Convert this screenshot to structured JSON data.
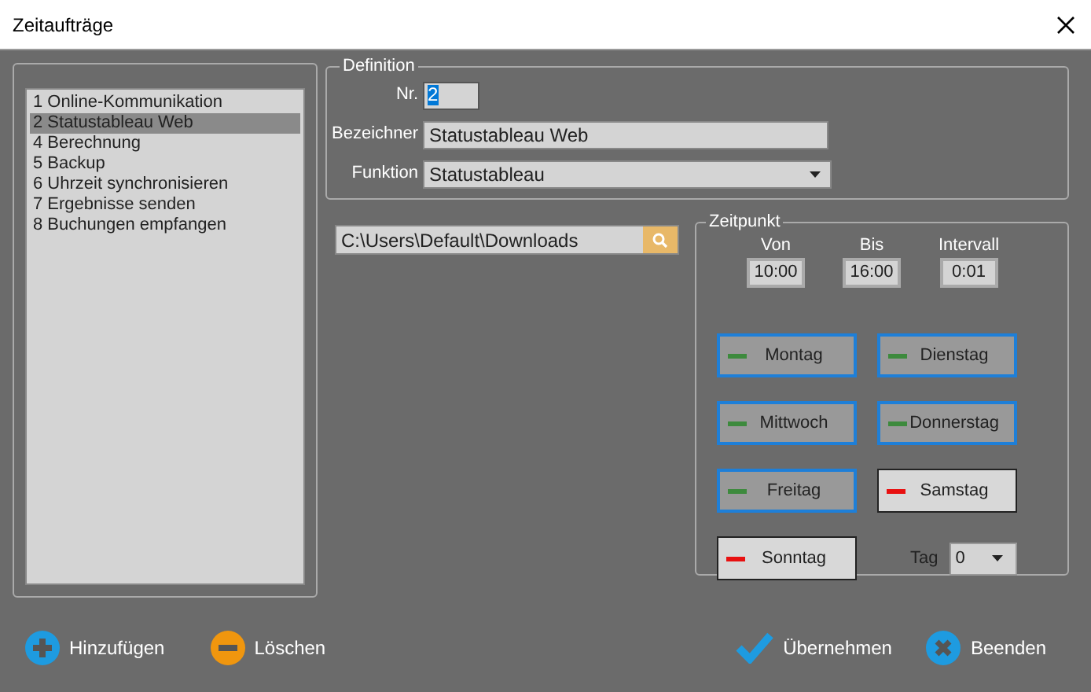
{
  "window": {
    "title": "Zeitaufträge"
  },
  "jobs": [
    {
      "label": "1 Online-Kommunikation",
      "selected": false
    },
    {
      "label": "2 Statustableau Web",
      "selected": true
    },
    {
      "label": "4 Berechnung",
      "selected": false
    },
    {
      "label": "5 Backup",
      "selected": false
    },
    {
      "label": "6 Uhrzeit synchronisieren",
      "selected": false
    },
    {
      "label": "7 Ergebnisse senden",
      "selected": false
    },
    {
      "label": "8 Buchungen empfangen",
      "selected": false
    }
  ],
  "definition": {
    "title": "Definition",
    "nr_label": "Nr.",
    "nr_value": "2",
    "name_label": "Bezeichner",
    "name_value": "Statustableau Web",
    "function_label": "Funktion",
    "function_value": "Statustableau"
  },
  "path": {
    "value": "C:\\Users\\Default\\Downloads"
  },
  "schedule": {
    "title": "Zeitpunkt",
    "from_label": "Von",
    "from_value": "10:00",
    "to_label": "Bis",
    "to_value": "16:00",
    "interval_label": "Intervall",
    "interval_value": "0:01",
    "days": [
      {
        "label": "Montag",
        "on": true
      },
      {
        "label": "Dienstag",
        "on": true
      },
      {
        "label": "Mittwoch",
        "on": true
      },
      {
        "label": "Donnerstag",
        "on": true
      },
      {
        "label": "Freitag",
        "on": true
      },
      {
        "label": "Samstag",
        "on": false
      },
      {
        "label": "Sonntag",
        "on": false
      }
    ],
    "day_label": "Tag",
    "day_value": "0"
  },
  "actions": [
    {
      "kind": "add",
      "label": "Hinzufügen"
    },
    {
      "kind": "delete",
      "label": "Löschen"
    },
    {
      "kind": "apply",
      "label": "Übernehmen"
    },
    {
      "kind": "close",
      "label": "Beenden"
    }
  ]
}
